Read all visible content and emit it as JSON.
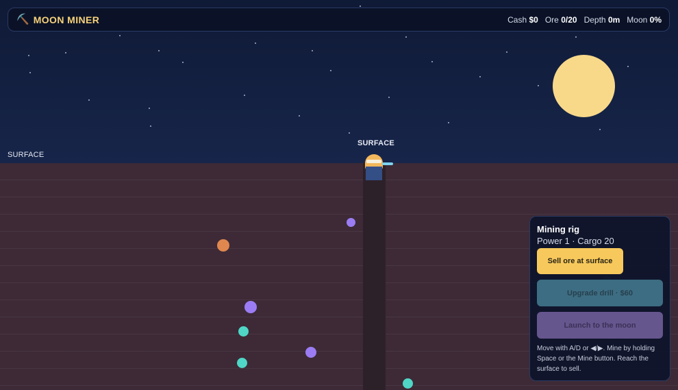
{
  "header": {
    "title": "MOON MINER",
    "icon": "pickaxe-icon",
    "stats": [
      {
        "label": "Cash",
        "value": "$0"
      },
      {
        "label": "Ore",
        "value": "0/20"
      },
      {
        "label": "Depth",
        "value": "0m"
      },
      {
        "label": "Moon",
        "value": "0%"
      }
    ]
  },
  "world": {
    "surface_label_left": "SURFACE",
    "surface_label_center": "SURFACE"
  },
  "panel": {
    "title": "Mining rig",
    "subtitle": "Power 1 · Cargo 20",
    "sell_label": "Sell ore at surface",
    "upgrade_label": "Upgrade drill · $60",
    "launch_label": "Launch to the moon",
    "help": "Move with A/D or ◀/▶. Mine by holding Space or the Mine button. Reach the surface to sell."
  },
  "colors": {
    "sky": "#15213f",
    "ground": "#3d2a36",
    "moon": "#f8d98a",
    "accent": "#f7d27a",
    "ore_purple": "#9b7cf4",
    "ore_teal": "#4fd6c6",
    "ore_orange": "#e0874f"
  }
}
